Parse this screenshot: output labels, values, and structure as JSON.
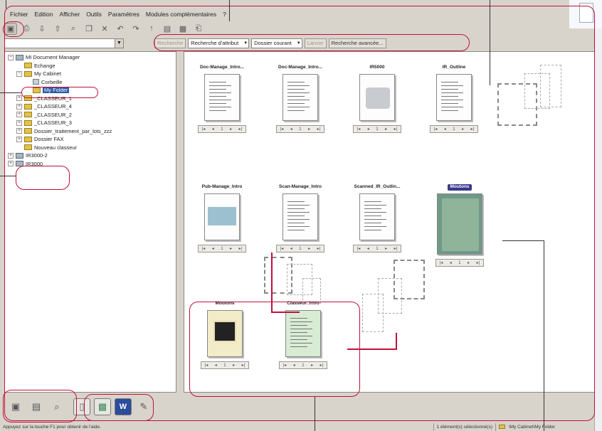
{
  "menu": [
    "Fichier",
    "Edition",
    "Afficher",
    "Outils",
    "Paramètres",
    "Modules complémentaires",
    "?"
  ],
  "toolbar": {
    "icons": [
      "cabinet-icon",
      "scan-icon",
      "import-icon",
      "export-icon",
      "find-icon",
      "copy-icon",
      "bin-icon",
      "undo-icon",
      "redo-icon",
      "up-icon",
      "view-icon",
      "grid-icon",
      "print-icon"
    ]
  },
  "search": {
    "path_value": "",
    "attr_btn": "Recherche",
    "attr_select": "Recherche d'attribut",
    "folder_select": "Dossier courant",
    "go_btn": "Lancer",
    "advanced_btn": "Recherche avancée..."
  },
  "tree": [
    {
      "label": "MI Document Manager",
      "exp": "-",
      "icon": "drv",
      "indent": 0
    },
    {
      "label": "Echange",
      "exp": "",
      "icon": "folder",
      "indent": 1
    },
    {
      "label": "My Cabinet",
      "exp": "-",
      "icon": "folder",
      "indent": 1
    },
    {
      "label": "Corbeille",
      "exp": "",
      "icon": "bin",
      "indent": 2
    },
    {
      "label": "My Folder",
      "exp": "",
      "icon": "folder",
      "indent": 2,
      "selected": true
    },
    {
      "label": "_CLASSEUR_1",
      "exp": "+",
      "icon": "folder",
      "indent": 1
    },
    {
      "label": "_CLASSEUR_4",
      "exp": "+",
      "icon": "folder",
      "indent": 1
    },
    {
      "label": "_CLASSEUR_2",
      "exp": "+",
      "icon": "folder",
      "indent": 1
    },
    {
      "label": "_CLASSEUR_3",
      "exp": "+",
      "icon": "folder",
      "indent": 1
    },
    {
      "label": "Dossier_traitement_par_lots_zzz",
      "exp": "+",
      "icon": "folder",
      "indent": 1
    },
    {
      "label": "Dossier FAX",
      "exp": "+",
      "icon": "folder",
      "indent": 1
    },
    {
      "label": "Nouveau classeur",
      "exp": "",
      "icon": "folder",
      "indent": 1
    },
    {
      "label": "IR3000-2",
      "exp": "+",
      "icon": "drv",
      "indent": 0
    },
    {
      "label": "IR3000",
      "exp": "+",
      "icon": "drv",
      "indent": 0
    }
  ],
  "docs": [
    {
      "title": "Doc-Manage_Intro...",
      "kind": "text"
    },
    {
      "title": "Doc-Manage_Intro...",
      "kind": "text"
    },
    {
      "title": "IR5000",
      "kind": "photo"
    },
    {
      "title": "IR_Outline",
      "kind": "text"
    },
    {
      "title": "Pub-Manage_Intro",
      "kind": "brochure"
    },
    {
      "title": "Scan-Manage_Intro",
      "kind": "text"
    },
    {
      "title": "Scanned_IR_Outlin...",
      "kind": "text"
    },
    {
      "title": "Moutons",
      "kind": "photo-green"
    },
    {
      "title": "Moutons",
      "kind": "brochure2"
    },
    {
      "title": "Classeur_Intro",
      "kind": "text-green"
    }
  ],
  "bottom_icons": [
    "cabinets-view-icon",
    "folders-view-icon",
    "search-view-icon",
    "page-view-icon",
    "image-view-icon",
    "word-icon",
    "bin-tool-icon"
  ],
  "status": {
    "hint": "Appuyez sur la touche F1 pour obtenir de l'aide.",
    "selection": "1 élément(s) sélectionné(s)",
    "location": "\\My Cabinet\\My Folder"
  }
}
